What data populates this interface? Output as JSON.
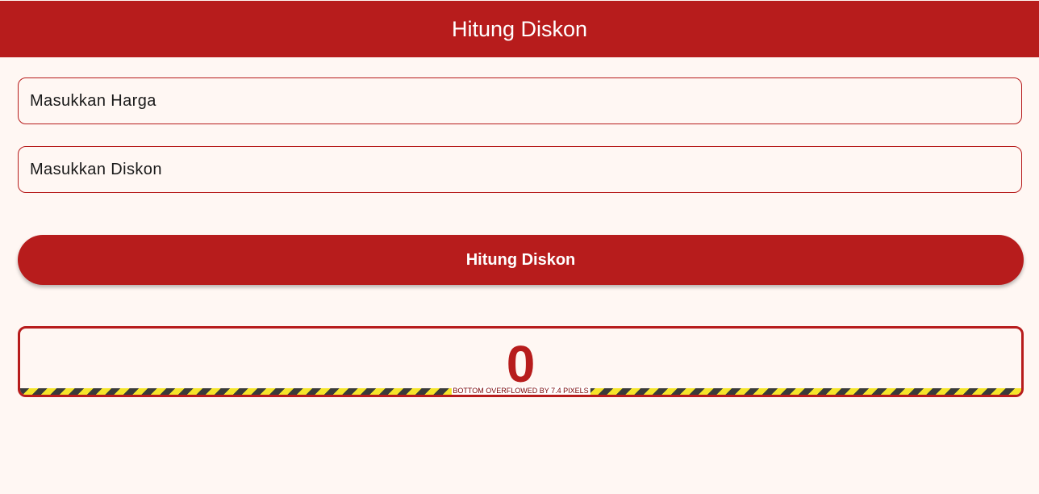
{
  "app_bar": {
    "title": "Hitung Diskon"
  },
  "form": {
    "harga_placeholder": "Masukkan Harga",
    "diskon_placeholder": "Masukkan Diskon"
  },
  "button": {
    "label": "Hitung Diskon"
  },
  "result": {
    "value": "0",
    "overflow_warning": "BOTTOM OVERFLOWED BY 7.4 PIXELS"
  },
  "colors": {
    "primary": "#B71C1C",
    "background": "#FFF7F3",
    "warning_dark": "#3a3a3a",
    "warning_yellow": "#F5E52A"
  }
}
